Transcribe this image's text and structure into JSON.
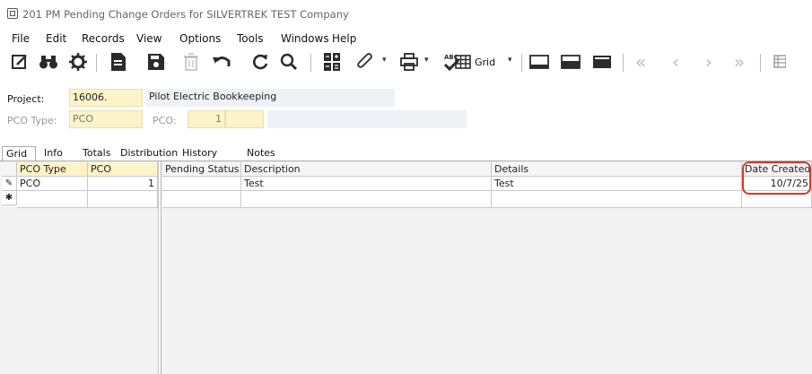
{
  "window": {
    "title": "201 PM Pending Change Orders for SILVERTREK TEST Company"
  },
  "menu": [
    "File",
    "Edit",
    "Records",
    "View",
    "Options",
    "Tools",
    "Windows",
    "Help"
  ],
  "toolbar": {
    "grid_label": "Grid"
  },
  "icons": {
    "app": "window-icon",
    "edit": "edit-icon",
    "find": "binoculars-icon",
    "settings": "gear-icon",
    "document": "document-icon",
    "save": "save-icon",
    "delete": "trash-icon",
    "undo": "undo-icon",
    "refresh": "refresh-icon",
    "search": "search-icon",
    "calculator": "calculator-icon",
    "attach": "paperclip-icon",
    "print": "print-icon",
    "spellcheck": "spellcheck-icon",
    "grid": "grid-icon",
    "layout": "layout-icon",
    "first": "first-record-icon",
    "prev": "prev-record-icon",
    "next": "next-record-icon",
    "last": "last-record-icon"
  },
  "header": {
    "project_label": "Project:",
    "project_value": "16006.",
    "project_name": "Pilot Electric Bookkeeping",
    "pco_type_label": "PCO Type:",
    "pco_type_value": "PCO",
    "pco_label": "PCO:",
    "pco_value": "1"
  },
  "tabs": [
    "Grid",
    "Info",
    "Totals",
    "Distribution",
    "History",
    "Notes"
  ],
  "grid": {
    "left_columns": [
      "PCO Type",
      "PCO"
    ],
    "right_columns": [
      "Pending Status",
      "Description",
      "Details",
      "Date Created"
    ],
    "rows": [
      {
        "pco_type": "PCO",
        "pco": "1",
        "pending_status": "",
        "description": "Test",
        "details": "Test",
        "date_created": "10/7/25"
      }
    ],
    "row_markers": {
      "edit": "✎",
      "new": "✱"
    }
  },
  "colors": {
    "highlight": "#d03a2a",
    "key_field": "#fdf3c8",
    "readonly_field": "#eef2f6"
  }
}
